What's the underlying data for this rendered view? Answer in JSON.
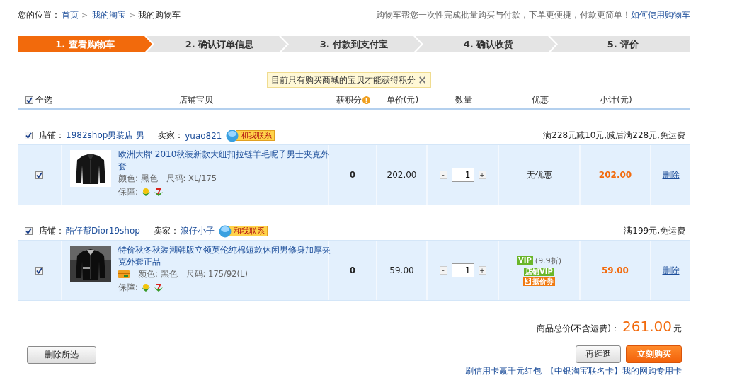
{
  "breadcrumb": {
    "label": "您的位置：",
    "links": [
      "首页",
      "我的淘宝"
    ],
    "current": "我的购物车",
    "separator": ">"
  },
  "help": {
    "text": "购物车帮您一次性完成批量购买与付款，下单更便捷，付款更简单！",
    "link": "如何使用购物车"
  },
  "steps": [
    {
      "label": "1. 查看购物车",
      "selected": true
    },
    {
      "label": "2. 确认订单信息",
      "selected": false
    },
    {
      "label": "3. 付款到支付宝",
      "selected": false
    },
    {
      "label": "4. 确认收货",
      "selected": false
    },
    {
      "label": "5. 评价",
      "selected": false
    }
  ],
  "notice": {
    "text": "目前只有购买商城的宝贝才能获得积分",
    "close": "×"
  },
  "table": {
    "select_all": {
      "label": "全选",
      "checked": true
    },
    "columns": [
      "店铺宝贝",
      "获积分",
      "单价(元)",
      "数量",
      "优惠",
      "小计(元)"
    ],
    "shops": [
      {
        "checked": true,
        "shop_label": "店铺：",
        "shop": "1982shop男装店 男",
        "seller_label": "卖家：",
        "seller": "yuao821",
        "contact": "和我联系",
        "promo": "满228元减10元,减后满228元,免运费",
        "items": [
          {
            "checked": true,
            "title": "欧洲大牌 2010秋装新款大纽扣拉链羊毛呢子男士夹克外套",
            "sku_color": "颜色: 黑色",
            "sku_size": "尺码: XL/175",
            "guarantee_label": "保障:",
            "guarantees": [
              {
                "kind": "flower"
              },
              {
                "kind": "seven"
              }
            ],
            "points": "0",
            "price": "202.00",
            "minus": "-",
            "qty": "1",
            "plus": "+",
            "discount_text": "无优惠",
            "subtotal": "202.00",
            "delete": "删除"
          }
        ]
      },
      {
        "checked": true,
        "shop_label": "店铺：",
        "shop": "酷仔帮Dior19shop",
        "seller_label": "卖家：",
        "seller": "浪仔小子",
        "contact": "和我联系",
        "promo": "满199元,免运费",
        "items": [
          {
            "checked": true,
            "title": "特价秋冬秋装潮韩版立领英伦纯棉短款休闲男修身加厚夹克外套正品",
            "tags": [
              {
                "kind": "card"
              }
            ],
            "sku_color": "颜色: 黑色",
            "sku_size": "尺码: 175/92(L)",
            "guarantee_label": "保障:",
            "guarantees": [
              {
                "kind": "flower"
              },
              {
                "kind": "seven"
              }
            ],
            "points": "0",
            "price": "59.00",
            "minus": "-",
            "qty": "1",
            "plus": "+",
            "badges": [
              {
                "kind": "vip",
                "text": "VIP",
                "note": "(9.9折)"
              },
              {
                "kind": "vip",
                "text": "店铺VIP"
              },
              {
                "kind": "coupon",
                "count": "3",
                "text": "抵价券"
              }
            ],
            "subtotal": "59.00",
            "delete": "删除"
          }
        ]
      }
    ]
  },
  "total": {
    "label": "商品总价(不含运费)：",
    "amount": "261.00",
    "unit": "元"
  },
  "delete_selected": "删除所选",
  "continue_button": "再逛逛",
  "buy_button": "立刻购买",
  "ad": {
    "text": "刷信用卡赢千元红包",
    "link": "【中银淘宝联名卡】我的网购专用卡"
  }
}
